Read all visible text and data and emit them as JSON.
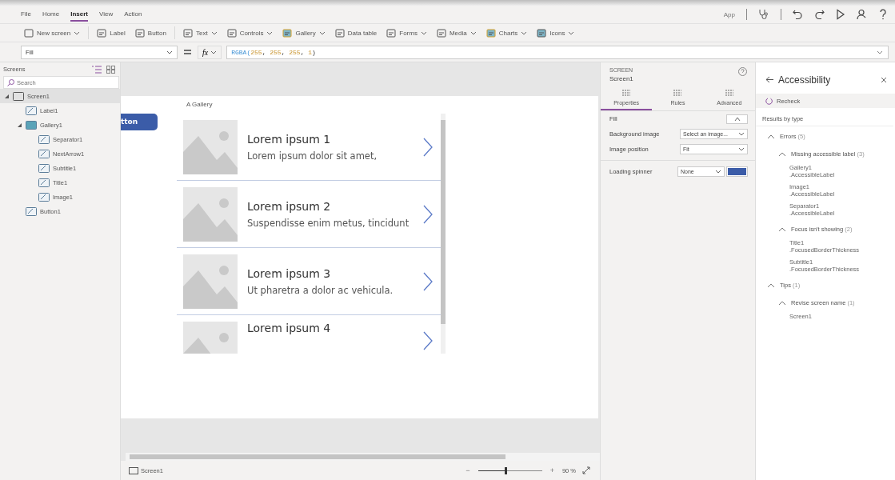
{
  "menu": [
    {
      "label": "File",
      "selected": false
    },
    {
      "label": "Home",
      "selected": false
    },
    {
      "label": "Insert",
      "selected": true
    },
    {
      "label": "View",
      "selected": false
    },
    {
      "label": "Action",
      "selected": false
    }
  ],
  "app_label": "App",
  "toolbar": [
    {
      "label": "New screen",
      "dropdown": true
    },
    {
      "label": "Label",
      "dropdown": false
    },
    {
      "label": "Button",
      "dropdown": false
    },
    {
      "label": "Text",
      "dropdown": true
    },
    {
      "label": "Controls",
      "dropdown": true
    },
    {
      "label": "Gallery",
      "dropdown": true
    },
    {
      "label": "Data table",
      "dropdown": false
    },
    {
      "label": "Forms",
      "dropdown": true
    },
    {
      "label": "Media",
      "dropdown": true
    },
    {
      "label": "Charts",
      "dropdown": true
    },
    {
      "label": "Icons",
      "dropdown": true
    }
  ],
  "formula_bar": {
    "property": "Fill",
    "fx": "fx",
    "tokens": [
      {
        "kind": "function",
        "text": "RGBA("
      },
      {
        "kind": "number",
        "text": "255"
      },
      {
        "kind": "punct",
        "text": ", "
      },
      {
        "kind": "number",
        "text": "255"
      },
      {
        "kind": "punct",
        "text": ", "
      },
      {
        "kind": "number",
        "text": "255"
      },
      {
        "kind": "punct",
        "text": ", "
      },
      {
        "kind": "number",
        "text": "1"
      },
      {
        "kind": "punct",
        "text": ")"
      }
    ]
  },
  "tree": {
    "title": "Screens",
    "search_placeholder": "Search",
    "items": [
      {
        "label": "Screen1",
        "selected": true,
        "expanded": true,
        "children": [
          {
            "label": "Label1",
            "selected": false
          },
          {
            "label": "Gallery1",
            "selected": false,
            "expanded": true,
            "children": [
              {
                "label": "Separator1",
                "selected": false
              },
              {
                "label": "NextArrow1",
                "selected": false
              },
              {
                "label": "Subtitle1",
                "selected": false
              },
              {
                "label": "Title1",
                "selected": false
              },
              {
                "label": "Image1",
                "selected": false
              }
            ]
          },
          {
            "label": "Button1",
            "selected": false
          }
        ]
      }
    ]
  },
  "canvas": {
    "button_text": "tton",
    "gallery_label": "A Gallery",
    "items": [
      {
        "title": "Lorem ipsum 1",
        "subtitle": "Lorem ipsum dolor sit amet,"
      },
      {
        "title": "Lorem ipsum 2",
        "subtitle": "Suspendisse enim metus, tincidunt"
      },
      {
        "title": "Lorem ipsum 3",
        "subtitle": "Ut pharetra a dolor ac vehicula."
      },
      {
        "title": "Lorem ipsum 4"
      }
    ]
  },
  "status_bar": {
    "screen": "Screen1",
    "zoom_minus": "−",
    "zoom_plus": "+",
    "zoom": "90 %",
    "level": 0.45
  },
  "properties": {
    "kind_label": "SCREEN",
    "name": "Screen1",
    "tabs": [
      {
        "label": "Properties",
        "selected": true
      },
      {
        "label": "Rules",
        "selected": false
      },
      {
        "label": "Advanced",
        "selected": false
      }
    ],
    "rows": [
      {
        "kind": "color",
        "label": "Fill"
      },
      {
        "kind": "select",
        "label": "Background image",
        "value": "Select an image..."
      },
      {
        "kind": "select",
        "label": "Image position",
        "value": "Fit"
      },
      {
        "kind": "select-color",
        "label": "Loading spinner",
        "value": "None",
        "color": "#3b5ca8"
      }
    ]
  },
  "accessibility": {
    "title": "Accessibility",
    "recheck": "Recheck",
    "results_heading": "Results by type",
    "groups": [
      {
        "label": "Errors",
        "count": "(5)",
        "expanded": true,
        "children": [
          {
            "label": "Missing accessible label",
            "count": "(3)",
            "expanded": true,
            "items": [
              {
                "name": "Gallery1",
                "property": ".AccessibleLabel"
              },
              {
                "name": "Image1",
                "property": ".AccessibleLabel"
              },
              {
                "name": "Separator1",
                "property": ".AccessibleLabel"
              }
            ]
          },
          {
            "label": "Focus isn't showing",
            "count": "(2)",
            "expanded": true,
            "items": [
              {
                "name": "Title1",
                "property": ".FocusedBorderThickness"
              },
              {
                "name": "Subtitle1",
                "property": ".FocusedBorderThickness"
              }
            ]
          }
        ]
      },
      {
        "label": "Tips",
        "count": "(1)",
        "expanded": true,
        "children": [
          {
            "label": "Revise screen name",
            "count": "(1)",
            "expanded": true,
            "items": [
              {
                "name": "Screen1"
              }
            ]
          }
        ]
      }
    ]
  }
}
